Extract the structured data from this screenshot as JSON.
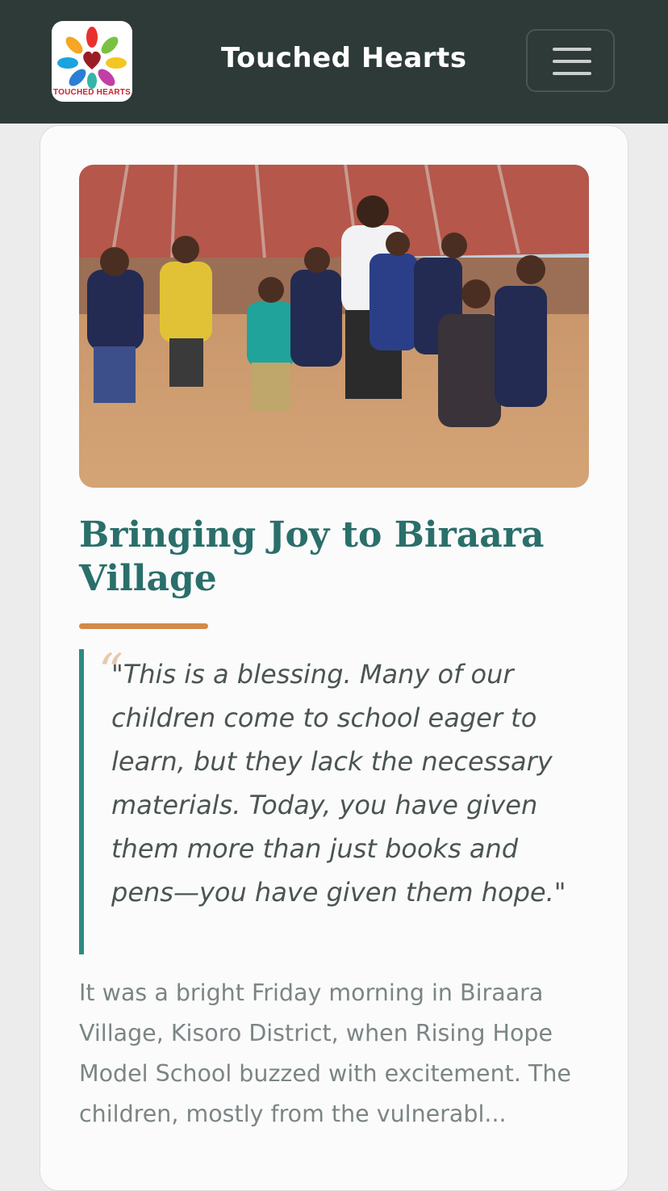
{
  "navbar": {
    "brand": "Touched Hearts",
    "logo_text": "TOUCHED HEARTS",
    "menu_icon": "hamburger-icon",
    "background": "#2d3a38"
  },
  "article": {
    "image_alt": "Children of Rising Hope Model School standing with a visitor in front of school buildings",
    "title": "Bringing Joy to Biraara Village",
    "quote": "\"This is a blessing. Many of our children come to school eager to learn, but they lack the necessary materials. Today, you have given them more than just books and pens—you have given them hope.\"",
    "excerpt": "It was a bright Friday morning in Biraara Village, Kisoro District, when Rising Hope Model School buzzed with excitement. The children, mostly from the vulnerabl...",
    "accent": "#d48a48",
    "title_color": "#2a6f6a",
    "quote_border": "#2e8a80"
  }
}
